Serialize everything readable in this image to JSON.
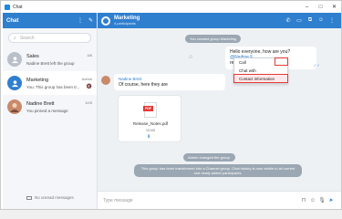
{
  "window": {
    "title": "Chat"
  },
  "sidebar": {
    "title": "Chat",
    "search_placeholder": "Search",
    "chats": [
      {
        "name": "Sales",
        "preview": "Nadine Brett left the group",
        "meta": "4/6"
      },
      {
        "name": "Marketing",
        "preview": "You: This group has been tr...",
        "meta": "Admin"
      },
      {
        "name": "Nadine Brett",
        "preview": "You pinned a message",
        "meta": "12/5"
      }
    ],
    "footer": "No unread messages"
  },
  "chat": {
    "title": "Marketing",
    "subtitle": "4 participants",
    "messages": {
      "created": "You created group Marketing",
      "hello": "Hello everyone, how are you?",
      "mention": "@Nadine E",
      "mention_rest": "release m",
      "incoming_sender": "Nadine Brett",
      "incoming_text": "Of course, here they are",
      "file_name": "Release_Notes.pdf",
      "file_size": "19 kB",
      "admin_changed": "Admin changed the group.",
      "converted": "This group has been transformed into a Channel group. Chat history is now visible to all current and newly added participants."
    },
    "context_menu": [
      "Call",
      "Chat with",
      "Contact information"
    ],
    "input_placeholder": "Type message"
  },
  "colors": {
    "accent": "#2f7fcf",
    "system_pill": "#9ba7b3",
    "highlight": "#e53935"
  }
}
